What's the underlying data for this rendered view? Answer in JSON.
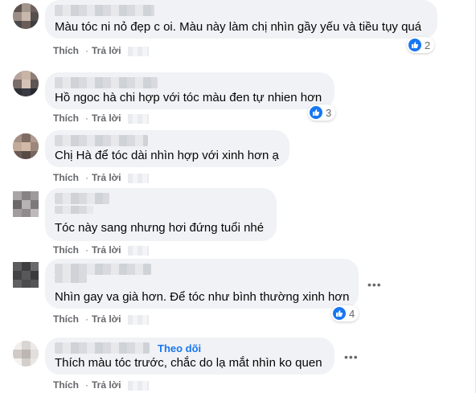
{
  "comments": [
    {
      "text": "Màu tóc ni nỏ đẹp c oi. Màu này làm chị nhìn gầy yếu và tiều tụy quá",
      "reactions": "2"
    },
    {
      "text": "Hồ ngoc hà chi hợp với tóc màu đen tự nhien hơn",
      "reactions": "3"
    },
    {
      "text": "Chị Hà để tóc dài nhìn hợp với xinh hơn ạ",
      "reactions": ""
    },
    {
      "text": "Tóc này sang nhưng hơi đứng tuổi nhé",
      "reactions": ""
    },
    {
      "text": "Nhìn gay va già hơn. Để tóc như bình thường xinh hơn",
      "reactions": "4"
    },
    {
      "text": "Thích màu tóc trước, chắc do lạ mắt nhìn ko quen",
      "reactions": "",
      "follow_label": "Theo dõi"
    }
  ],
  "actions": {
    "like": "Thích",
    "reply": "Trả lời",
    "separator": "·"
  },
  "icons": {
    "like": "like-thumb-icon",
    "more": "more-options-icon"
  },
  "colors": {
    "bubble": "#f0f2f5",
    "accent": "#1877f2",
    "meta": "#65676b"
  }
}
